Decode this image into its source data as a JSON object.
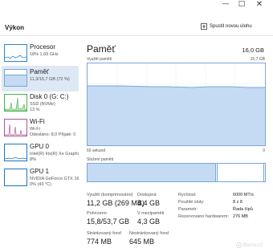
{
  "header": {
    "title": "Výkon",
    "action_label": "Spustit novou úlohu"
  },
  "window": {
    "minimize": "—",
    "maximize": "□",
    "close": "✕"
  },
  "sidebar": {
    "items": [
      {
        "name": "Procesor",
        "sub1": "18%  1,69 GHz",
        "sub2": "",
        "color": "#2f88c9"
      },
      {
        "name": "Paměť",
        "sub1": "11,3/15,7 GB (72 %)",
        "sub2": "",
        "color": "#7aa7d8"
      },
      {
        "name": "Disk 0 (G: C:)",
        "sub1": "SSD (NVMe)",
        "sub2": "13 %",
        "color": "#4caf50"
      },
      {
        "name": "Wi-Fi",
        "sub1": "Wi-Fi",
        "sub2": "Odesláno: 8,0 Přijaté: 0",
        "color": "#b5529b"
      },
      {
        "name": "GPU 0",
        "sub1": "Intel(R) Iris(R) Xe Graphi",
        "sub2": "8%",
        "color": "#1e73be"
      },
      {
        "name": "GPU 1",
        "sub1": "NVIDIA GeForce GTX 16",
        "sub2": "0% (43 °C)",
        "color": "#1e73be"
      }
    ]
  },
  "main": {
    "title": "Paměť",
    "total": "16,0 GB",
    "usage_label": "Využití paměti",
    "usage_max": "15,7 GB",
    "time_label": "60 sekund",
    "time_end": "0",
    "composition_label": "Složení paměti",
    "usage_fraction": 0.72
  },
  "stats": {
    "in_use": {
      "label": "Využití (komprimováno)",
      "value": "11,2 GB (269 MB)"
    },
    "available": {
      "label": "Dostupná",
      "value": "4,4 GB"
    },
    "committed": {
      "label": "Potvrzeno",
      "value": "15,8/53,7 GB"
    },
    "cached": {
      "label": "V mezipaměti",
      "value": "4,3 GB"
    },
    "paged": {
      "label": "Stránkovaný fond",
      "value": "774 MB"
    },
    "nonpaged": {
      "label": "Nestránkovaný fond",
      "value": "645 MB"
    }
  },
  "details": [
    {
      "key": "Rychlost:",
      "value": "6000 MT/s"
    },
    {
      "key": "Použité sloty:",
      "value": "8 z 8"
    },
    {
      "key": "Parametr:",
      "value": "Řada čipů"
    },
    {
      "key": "Rezervováno hardwarem:",
      "value": "276 MB"
    }
  ],
  "watermark": "Bazos.cz",
  "colors": {
    "memory_accent": "#7aa7d8",
    "memory_fill": "#c5daf3",
    "selected_bg": "#dde8f4"
  }
}
